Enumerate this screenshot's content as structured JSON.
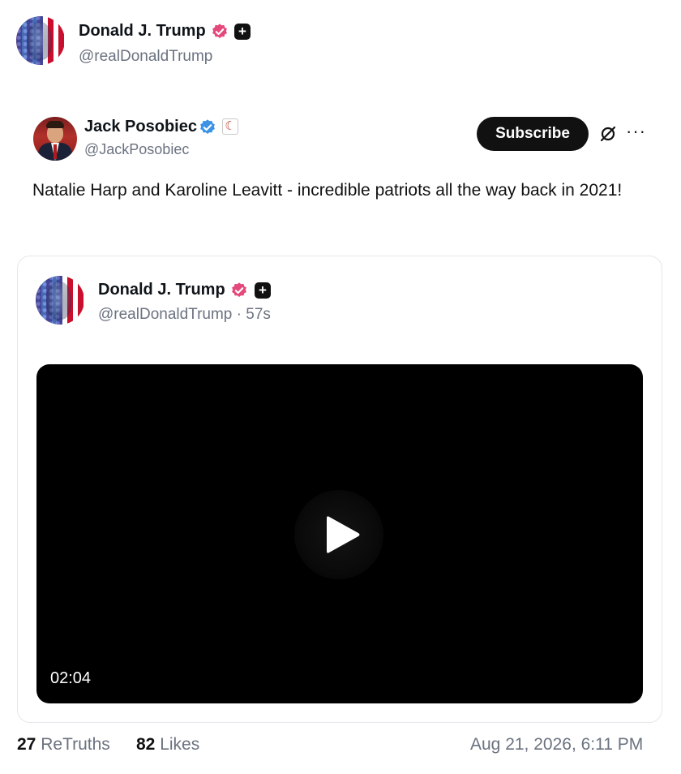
{
  "top_author": {
    "name": "Donald J. Trump",
    "handle": "@realDonaldTrump",
    "plus_badge": "+"
  },
  "retruth": {
    "author_name": "Jack Posobiec",
    "author_handle": "@JackPosobiec",
    "flair_glyph": "☾",
    "subscribe_label": "Subscribe",
    "more_label": "···",
    "text": "Natalie Harp and Karoline Leavitt - incredible patriots all the way back in 2021!"
  },
  "quoted": {
    "author_name": "Donald J. Trump",
    "author_handle": "@realDonaldTrump · 57s",
    "plus_badge": "+",
    "video_duration": "02:04"
  },
  "stats": {
    "retruths_count": "27",
    "retruths_label": "ReTruths",
    "likes_count": "82",
    "likes_label": "Likes",
    "timestamp": "Aug 21, 2026, 6:11 PM"
  },
  "colors": {
    "verified_pink": "#e5487a",
    "verified_blue": "#3b93e6",
    "button_dark": "#111111",
    "muted_text": "#6b7280"
  },
  "icons": [
    "verified-badge-icon",
    "plus-badge-icon",
    "crescent-flair-icon",
    "no-subscribe-icon",
    "more-icon",
    "play-icon"
  ]
}
